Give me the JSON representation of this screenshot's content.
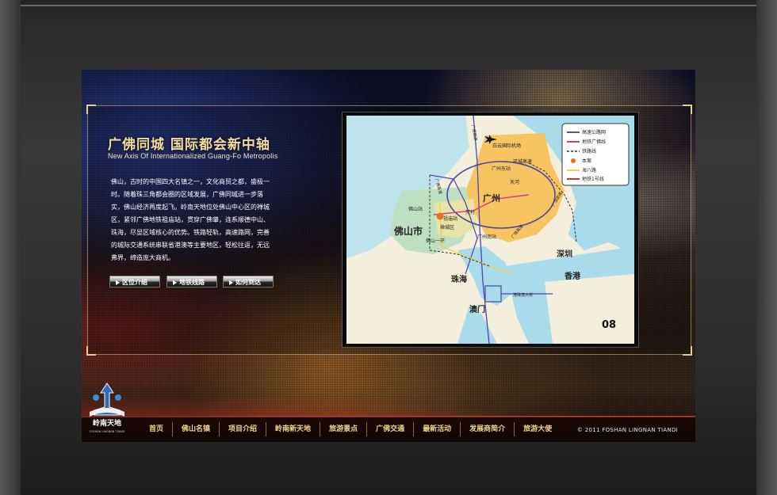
{
  "page": {
    "title_cn": "广佛同城   国际都会新中轴",
    "title_en": "New Axis Of Internationalized Guang-Fo Metropolis",
    "paragraph": "佛山，古时的中国四大名镇之一，文化商贸之都，盛极一时。随着珠三角都会圈的区域发展，广佛同城进一步落实，佛山经济再度起飞。岭南天地位处佛山中心区的禅城区，紧邻广佛地铁祖庙站，贯穿广佛肇，连系顺德中山、珠海，尽显区域核心的优势。铁路轻轨，高速路网，完善的城际交通系统串联省港澳等主要地区，轻松往返，无远弗界，缔造庞大商机。"
  },
  "buttons": [
    {
      "label": "区位介绍"
    },
    {
      "label": "地铁线路"
    },
    {
      "label": "如何到达"
    }
  ],
  "map": {
    "legend": [
      {
        "label": "高速公路网",
        "color": "#5a4fb0"
      },
      {
        "label": "地铁广佛线",
        "color": "#d23a8a"
      },
      {
        "label": "铁路线",
        "color": "#333333"
      },
      {
        "label": "本案",
        "color": "#e8731f"
      },
      {
        "label": "海八路",
        "color": "#f0d24a"
      },
      {
        "label": "地铁1号线",
        "color": "#c0392b"
      }
    ],
    "labels": {
      "airport": "白云国际机场",
      "ring": "环城高速",
      "guangzhou_east": "广州东站",
      "tianhe": "天河",
      "guangzhou": "广州",
      "foshan_city": "佛山市",
      "foshan_station": "佛山站",
      "zumiao": "祖庙站",
      "chancheng": "禅城区",
      "guangzhou_south": "广州南站",
      "foshan_ring1": "佛山一环",
      "fangcun": "芳村",
      "shenzhen": "深圳",
      "hongkong": "香港",
      "zhuhai": "珠海",
      "macau": "澳门",
      "bridge": "港珠澳大桥",
      "page_no": "08",
      "guangqing": "广清高速",
      "guangfo": "广佛高速",
      "guangshen": "广深高速",
      "guangzhu": "广珠高速",
      "jingzhu": "京港澳高速"
    }
  },
  "footer": {
    "nav": [
      "首页",
      "佛山名镇",
      "项目介绍",
      "岭南新天地",
      "旅游景点",
      "广佛交通",
      "最新活动",
      "发展商简介",
      "旅游大使"
    ],
    "copyright": "© 2011 FOSHAN LINGNAN TIANDI",
    "logo_text": "岭南天地",
    "logo_sub": "FOSHAN LINGNAN TIANDI"
  }
}
